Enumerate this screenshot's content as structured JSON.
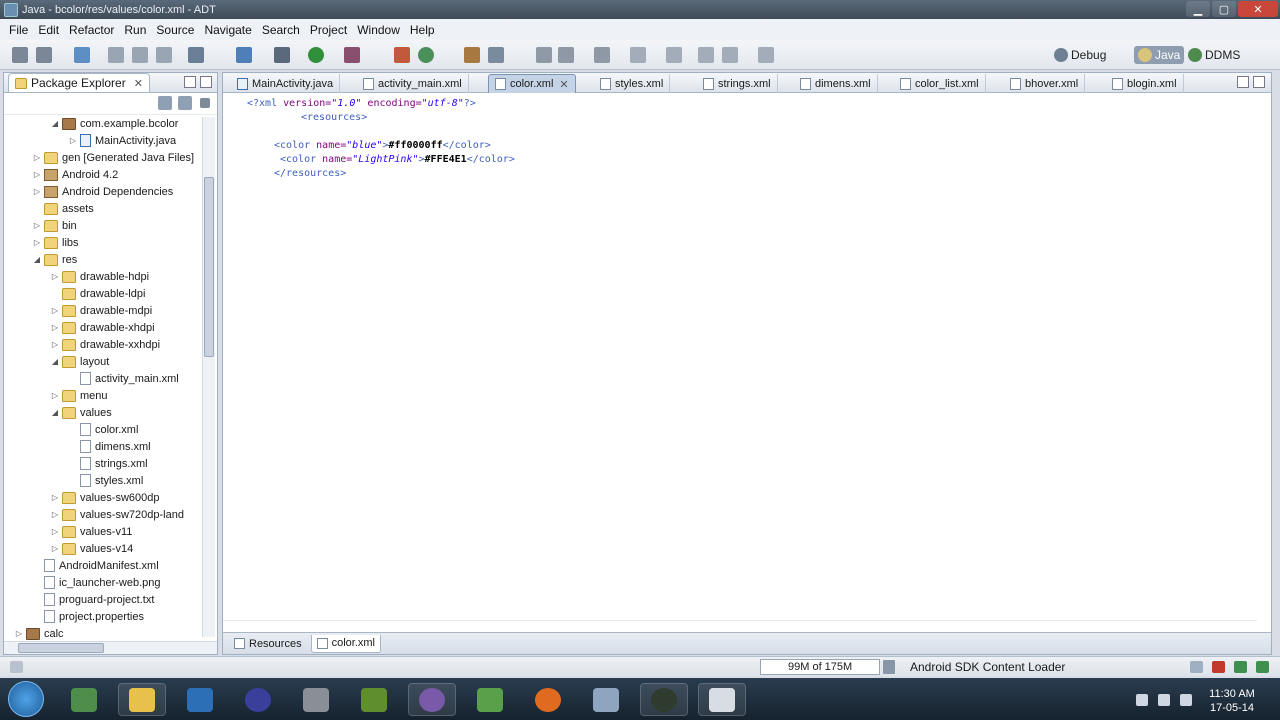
{
  "window": {
    "title": "Java - bcolor/res/values/color.xml - ADT"
  },
  "menu": [
    "File",
    "Edit",
    "Refactor",
    "Run",
    "Source",
    "Navigate",
    "Search",
    "Project",
    "Window",
    "Help"
  ],
  "perspectives": {
    "debug": "Debug",
    "java": "Java",
    "ddms": "DDMS"
  },
  "left_panel": {
    "tab_label": "Package Explorer",
    "tab_close": "✕",
    "tree": [
      {
        "label": "com.example.bcolor",
        "indent": 1,
        "twisty": "open",
        "icon": "pkg"
      },
      {
        "label": "MainActivity.java",
        "indent": 2,
        "twisty": "closed",
        "icon": "java"
      },
      {
        "label": "gen [Generated Java Files]",
        "indent": 0,
        "twisty": "closed",
        "icon": "folder"
      },
      {
        "label": "Android 4.2",
        "indent": 0,
        "twisty": "closed",
        "icon": "lib"
      },
      {
        "label": "Android Dependencies",
        "indent": 0,
        "twisty": "closed",
        "icon": "lib"
      },
      {
        "label": "assets",
        "indent": 0,
        "twisty": "none",
        "icon": "folder"
      },
      {
        "label": "bin",
        "indent": 0,
        "twisty": "closed",
        "icon": "folder"
      },
      {
        "label": "libs",
        "indent": 0,
        "twisty": "closed",
        "icon": "folder"
      },
      {
        "label": "res",
        "indent": 0,
        "twisty": "open",
        "icon": "folder"
      },
      {
        "label": "drawable-hdpi",
        "indent": 1,
        "twisty": "closed",
        "icon": "folder"
      },
      {
        "label": "drawable-ldpi",
        "indent": 1,
        "twisty": "none",
        "icon": "folder"
      },
      {
        "label": "drawable-mdpi",
        "indent": 1,
        "twisty": "closed",
        "icon": "folder"
      },
      {
        "label": "drawable-xhdpi",
        "indent": 1,
        "twisty": "closed",
        "icon": "folder"
      },
      {
        "label": "drawable-xxhdpi",
        "indent": 1,
        "twisty": "closed",
        "icon": "folder"
      },
      {
        "label": "layout",
        "indent": 1,
        "twisty": "open",
        "icon": "folder"
      },
      {
        "label": "activity_main.xml",
        "indent": 2,
        "twisty": "none",
        "icon": "file"
      },
      {
        "label": "menu",
        "indent": 1,
        "twisty": "closed",
        "icon": "folder"
      },
      {
        "label": "values",
        "indent": 1,
        "twisty": "open",
        "icon": "folder"
      },
      {
        "label": "color.xml",
        "indent": 2,
        "twisty": "none",
        "icon": "file"
      },
      {
        "label": "dimens.xml",
        "indent": 2,
        "twisty": "none",
        "icon": "file"
      },
      {
        "label": "strings.xml",
        "indent": 2,
        "twisty": "none",
        "icon": "file"
      },
      {
        "label": "styles.xml",
        "indent": 2,
        "twisty": "none",
        "icon": "file"
      },
      {
        "label": "values-sw600dp",
        "indent": 1,
        "twisty": "closed",
        "icon": "folder"
      },
      {
        "label": "values-sw720dp-land",
        "indent": 1,
        "twisty": "closed",
        "icon": "folder"
      },
      {
        "label": "values-v11",
        "indent": 1,
        "twisty": "closed",
        "icon": "folder"
      },
      {
        "label": "values-v14",
        "indent": 1,
        "twisty": "closed",
        "icon": "folder"
      },
      {
        "label": "AndroidManifest.xml",
        "indent": 0,
        "twisty": "none",
        "icon": "file"
      },
      {
        "label": "ic_launcher-web.png",
        "indent": 0,
        "twisty": "none",
        "icon": "file"
      },
      {
        "label": "proguard-project.txt",
        "indent": 0,
        "twisty": "none",
        "icon": "file"
      },
      {
        "label": "project.properties",
        "indent": 0,
        "twisty": "none",
        "icon": "file"
      },
      {
        "label": "calc",
        "indent": -1,
        "twisty": "closed",
        "icon": "pkg"
      }
    ]
  },
  "editor": {
    "tabs": [
      {
        "label": "MainActivity.java",
        "icon": "java",
        "active": false
      },
      {
        "label": "activity_main.xml",
        "icon": "xml",
        "active": false
      },
      {
        "label": "color.xml",
        "icon": "xml",
        "active": true
      },
      {
        "label": "styles.xml",
        "icon": "xml",
        "active": false
      },
      {
        "label": "strings.xml",
        "icon": "xml",
        "active": false
      },
      {
        "label": "dimens.xml",
        "icon": "xml",
        "active": false
      },
      {
        "label": "color_list.xml",
        "icon": "xml",
        "active": false
      },
      {
        "label": "bhover.xml",
        "icon": "xml",
        "active": false
      },
      {
        "label": "blogin.xml",
        "icon": "xml",
        "active": false
      }
    ],
    "code": {
      "decl_open": "<?xml ",
      "decl_version_attr": "version=",
      "decl_version_val": "\"1.0\"",
      "decl_encoding_attr": " encoding=",
      "decl_encoding_val": "\"utf-8\"",
      "decl_close": "?>",
      "resources_open": "<resources>",
      "color1_open": "<color ",
      "color1_attr": "name=",
      "color1_name": "\"blue\"",
      "color1_gt": ">",
      "color1_value": "#ff0000ff",
      "color1_close": "</color>",
      "color2_open": "<color ",
      "color2_attr": "name=",
      "color2_name": "\"LightPink\"",
      "color2_gt": ">",
      "color2_value": "#FFE4E1",
      "color2_close": "</color>",
      "resources_close": "</resources>"
    },
    "bottom_tabs": [
      "Resources",
      "color.xml"
    ]
  },
  "status": {
    "memory": "99M of 175M",
    "task": "Android SDK Content Loader"
  },
  "taskbar": {
    "time": "11:30 AM",
    "date": "17-05-14"
  }
}
